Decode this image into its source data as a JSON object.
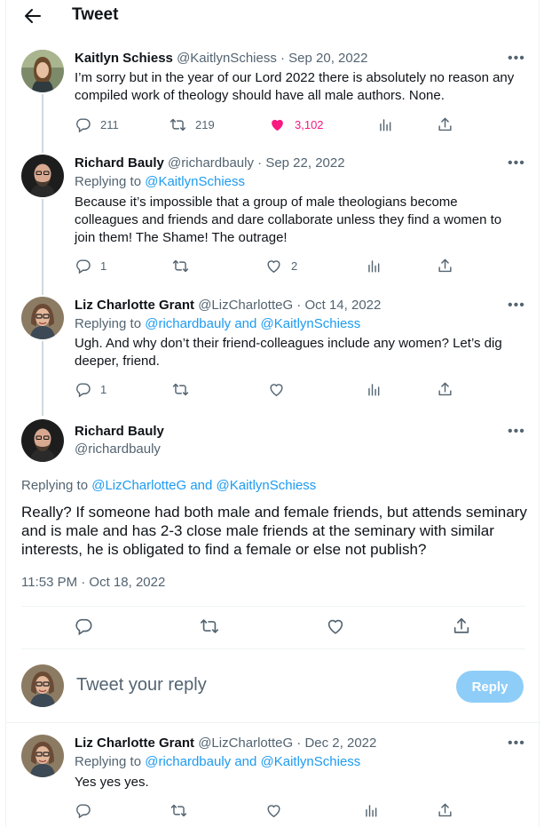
{
  "header": {
    "title": "Tweet"
  },
  "tweet1": {
    "name": "Kaitlyn Schiess",
    "handle": "@KaitlynSchiess",
    "date": "· Sep 20, 2022",
    "text": "I’m sorry but in the year of our Lord 2022 there is absolutely no reason any compiled work of theology should have all male authors. None.",
    "replies": "211",
    "retweets": "219",
    "likes": "3,102",
    "liked": true,
    "like_color": "#f91880"
  },
  "tweet2": {
    "name": "Richard Bauly",
    "handle": "@richardbauly",
    "date": "· Sep 22, 2022",
    "replying_prefix": "Replying to",
    "replying_to": "@KaitlynSchiess",
    "text": "Because it’s impossible that a group of male theologians become colleagues and friends and dare collaborate unless they find a women to join them!  The Shame!  The outrage!",
    "replies": "1",
    "likes": "2"
  },
  "tweet3": {
    "name": "Liz Charlotte Grant",
    "handle": "@LizCharlotteG",
    "date": "· Oct 14, 2022",
    "replying_prefix": "Replying to",
    "replying_to": "@richardbauly and @KaitlynSchiess",
    "text": "Ugh. And why don’t their friend-colleagues include any women? Let’s dig deeper, friend.",
    "replies": "1"
  },
  "main_tweet": {
    "name": "Richard Bauly",
    "handle": "@richardbauly",
    "replying_prefix": "Replying to",
    "replying_to": "@LizCharlotteG and @KaitlynSchiess",
    "text": "Really?  If someone had both male and female friends, but attends seminary and is male and has 2-3 close male friends at the seminary with similar interests, he is obligated to find a female or else not publish?",
    "timestamp": "11:53 PM · Oct 18, 2022"
  },
  "compose": {
    "placeholder": "Tweet your reply",
    "button": "Reply"
  },
  "tweet4": {
    "name": "Liz Charlotte Grant",
    "handle": "@LizCharlotteG",
    "date": "· Dec 2, 2022",
    "replying_prefix": "Replying to",
    "replying_to": "@richardbauly and @KaitlynSchiess",
    "text": "Yes yes yes."
  },
  "more_glyph": "•••",
  "accent": "#1d9bf0"
}
